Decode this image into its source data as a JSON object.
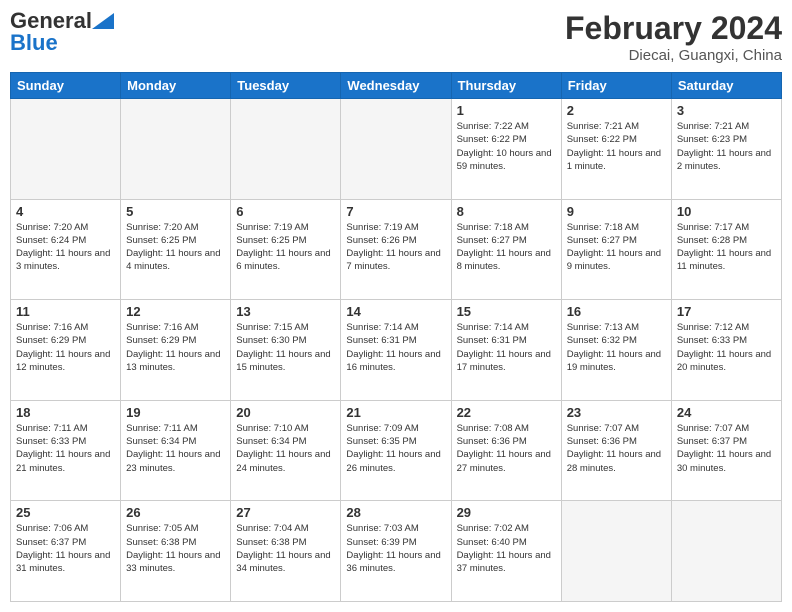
{
  "header": {
    "logo_general": "General",
    "logo_blue": "Blue",
    "title": "February 2024",
    "location": "Diecai, Guangxi, China"
  },
  "days_of_week": [
    "Sunday",
    "Monday",
    "Tuesday",
    "Wednesday",
    "Thursday",
    "Friday",
    "Saturday"
  ],
  "weeks": [
    [
      null,
      null,
      null,
      null,
      {
        "day": 1,
        "sunrise": "7:22 AM",
        "sunset": "6:22 PM",
        "daylight": "10 hours and 59 minutes."
      },
      {
        "day": 2,
        "sunrise": "7:21 AM",
        "sunset": "6:22 PM",
        "daylight": "11 hours and 1 minute."
      },
      {
        "day": 3,
        "sunrise": "7:21 AM",
        "sunset": "6:23 PM",
        "daylight": "11 hours and 2 minutes."
      }
    ],
    [
      {
        "day": 4,
        "sunrise": "7:20 AM",
        "sunset": "6:24 PM",
        "daylight": "11 hours and 3 minutes."
      },
      {
        "day": 5,
        "sunrise": "7:20 AM",
        "sunset": "6:25 PM",
        "daylight": "11 hours and 4 minutes."
      },
      {
        "day": 6,
        "sunrise": "7:19 AM",
        "sunset": "6:25 PM",
        "daylight": "11 hours and 6 minutes."
      },
      {
        "day": 7,
        "sunrise": "7:19 AM",
        "sunset": "6:26 PM",
        "daylight": "11 hours and 7 minutes."
      },
      {
        "day": 8,
        "sunrise": "7:18 AM",
        "sunset": "6:27 PM",
        "daylight": "11 hours and 8 minutes."
      },
      {
        "day": 9,
        "sunrise": "7:18 AM",
        "sunset": "6:27 PM",
        "daylight": "11 hours and 9 minutes."
      },
      {
        "day": 10,
        "sunrise": "7:17 AM",
        "sunset": "6:28 PM",
        "daylight": "11 hours and 11 minutes."
      }
    ],
    [
      {
        "day": 11,
        "sunrise": "7:16 AM",
        "sunset": "6:29 PM",
        "daylight": "11 hours and 12 minutes."
      },
      {
        "day": 12,
        "sunrise": "7:16 AM",
        "sunset": "6:29 PM",
        "daylight": "11 hours and 13 minutes."
      },
      {
        "day": 13,
        "sunrise": "7:15 AM",
        "sunset": "6:30 PM",
        "daylight": "11 hours and 15 minutes."
      },
      {
        "day": 14,
        "sunrise": "7:14 AM",
        "sunset": "6:31 PM",
        "daylight": "11 hours and 16 minutes."
      },
      {
        "day": 15,
        "sunrise": "7:14 AM",
        "sunset": "6:31 PM",
        "daylight": "11 hours and 17 minutes."
      },
      {
        "day": 16,
        "sunrise": "7:13 AM",
        "sunset": "6:32 PM",
        "daylight": "11 hours and 19 minutes."
      },
      {
        "day": 17,
        "sunrise": "7:12 AM",
        "sunset": "6:33 PM",
        "daylight": "11 hours and 20 minutes."
      }
    ],
    [
      {
        "day": 18,
        "sunrise": "7:11 AM",
        "sunset": "6:33 PM",
        "daylight": "11 hours and 21 minutes."
      },
      {
        "day": 19,
        "sunrise": "7:11 AM",
        "sunset": "6:34 PM",
        "daylight": "11 hours and 23 minutes."
      },
      {
        "day": 20,
        "sunrise": "7:10 AM",
        "sunset": "6:34 PM",
        "daylight": "11 hours and 24 minutes."
      },
      {
        "day": 21,
        "sunrise": "7:09 AM",
        "sunset": "6:35 PM",
        "daylight": "11 hours and 26 minutes."
      },
      {
        "day": 22,
        "sunrise": "7:08 AM",
        "sunset": "6:36 PM",
        "daylight": "11 hours and 27 minutes."
      },
      {
        "day": 23,
        "sunrise": "7:07 AM",
        "sunset": "6:36 PM",
        "daylight": "11 hours and 28 minutes."
      },
      {
        "day": 24,
        "sunrise": "7:07 AM",
        "sunset": "6:37 PM",
        "daylight": "11 hours and 30 minutes."
      }
    ],
    [
      {
        "day": 25,
        "sunrise": "7:06 AM",
        "sunset": "6:37 PM",
        "daylight": "11 hours and 31 minutes."
      },
      {
        "day": 26,
        "sunrise": "7:05 AM",
        "sunset": "6:38 PM",
        "daylight": "11 hours and 33 minutes."
      },
      {
        "day": 27,
        "sunrise": "7:04 AM",
        "sunset": "6:38 PM",
        "daylight": "11 hours and 34 minutes."
      },
      {
        "day": 28,
        "sunrise": "7:03 AM",
        "sunset": "6:39 PM",
        "daylight": "11 hours and 36 minutes."
      },
      {
        "day": 29,
        "sunrise": "7:02 AM",
        "sunset": "6:40 PM",
        "daylight": "11 hours and 37 minutes."
      },
      null,
      null
    ]
  ]
}
